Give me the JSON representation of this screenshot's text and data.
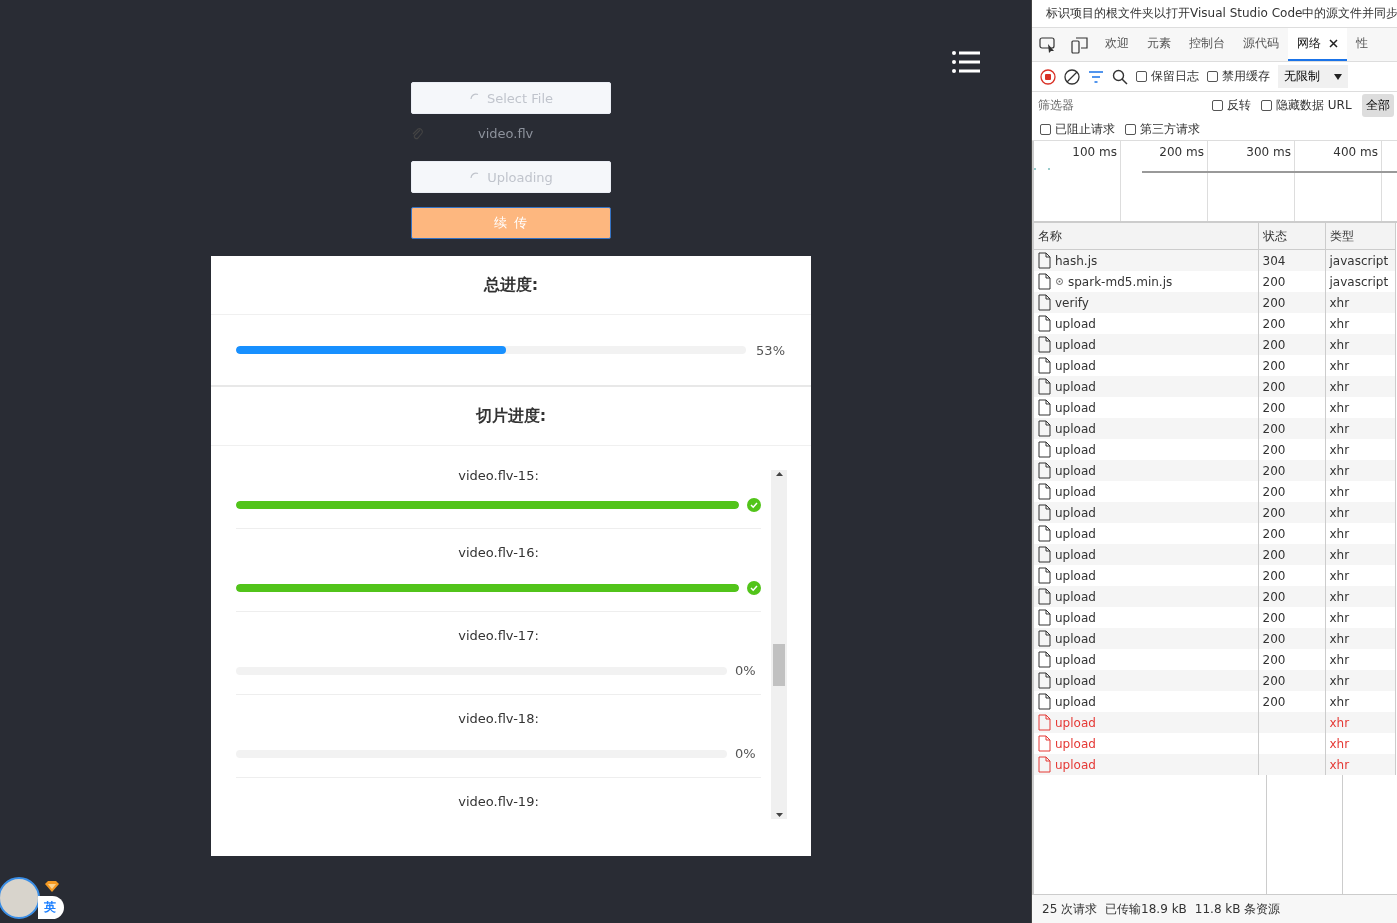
{
  "uploader": {
    "buttons": [
      {
        "kind": "select",
        "label": "Select File",
        "loading": true
      },
      {
        "kind": "file",
        "label": "video.flv"
      },
      {
        "kind": "upload",
        "label": "Uploading",
        "loading": true
      },
      {
        "kind": "resume",
        "label": "续 传",
        "focused": true
      }
    ]
  },
  "total_progress": {
    "title": "总进度:",
    "level": 0.53,
    "reading": "53%"
  },
  "chunk_progress": {
    "title": "切片进度:",
    "items": [
      {
        "label": "video.flv-15:",
        "level": 1,
        "completed": true
      },
      {
        "label": "video.flv-16:",
        "level": 1,
        "completed": true
      },
      {
        "label": "video.flv-17:",
        "level": 0,
        "completed": false,
        "reading": "0%"
      },
      {
        "label": "video.flv-18:",
        "level": 0,
        "completed": false,
        "reading": "0%"
      },
      {
        "label": "video.flv-19:"
      }
    ]
  },
  "user_badge": {
    "label": "英"
  },
  "devtools": {
    "info_bar": "标识项目的根文件夹以打开Visual Studio Code中的源文件并同步",
    "tabs": [
      {
        "label": "欢迎",
        "selected": false
      },
      {
        "label": "元素",
        "selected": false
      },
      {
        "label": "控制台",
        "selected": false
      },
      {
        "label": "源代码",
        "selected": false
      },
      {
        "label": "网络",
        "selected": true,
        "closable": true
      },
      {
        "label": "性",
        "selected": false
      }
    ],
    "toolbar": {
      "recording": true,
      "checkboxes": [
        {
          "label": "保留日志",
          "checked": false
        },
        {
          "label": "禁用缓存",
          "checked": false
        }
      ],
      "throttle": "无限制"
    },
    "filter": {
      "placeholder": "筛选器",
      "checkboxes": [
        {
          "label": "反转",
          "checked": false
        },
        {
          "label": "隐藏数据 URL",
          "checked": false
        }
      ],
      "type_button": {
        "label": "全部",
        "selected": true
      }
    },
    "request_filters": [
      {
        "label": "已阻止请求",
        "checked": false
      },
      {
        "label": "第三方请求",
        "checked": false
      }
    ],
    "timeline_ticks": [
      "100 ms",
      "200 ms",
      "300 ms",
      "400 ms"
    ],
    "columns": [
      "名称",
      "状态",
      "类型"
    ],
    "rows": [
      {
        "name": "hash.js",
        "status": "304",
        "type": "javascript",
        "failed": false
      },
      {
        "name": "spark-md5.min.js",
        "status": "200",
        "type": "javascript",
        "failed": false,
        "worker": true
      },
      {
        "name": "verify",
        "status": "200",
        "type": "xhr",
        "failed": false
      },
      {
        "name": "upload",
        "status": "200",
        "type": "xhr",
        "failed": false
      },
      {
        "name": "upload",
        "status": "200",
        "type": "xhr",
        "failed": false
      },
      {
        "name": "upload",
        "status": "200",
        "type": "xhr",
        "failed": false
      },
      {
        "name": "upload",
        "status": "200",
        "type": "xhr",
        "failed": false
      },
      {
        "name": "upload",
        "status": "200",
        "type": "xhr",
        "failed": false
      },
      {
        "name": "upload",
        "status": "200",
        "type": "xhr",
        "failed": false
      },
      {
        "name": "upload",
        "status": "200",
        "type": "xhr",
        "failed": false
      },
      {
        "name": "upload",
        "status": "200",
        "type": "xhr",
        "failed": false
      },
      {
        "name": "upload",
        "status": "200",
        "type": "xhr",
        "failed": false
      },
      {
        "name": "upload",
        "status": "200",
        "type": "xhr",
        "failed": false
      },
      {
        "name": "upload",
        "status": "200",
        "type": "xhr",
        "failed": false
      },
      {
        "name": "upload",
        "status": "200",
        "type": "xhr",
        "failed": false
      },
      {
        "name": "upload",
        "status": "200",
        "type": "xhr",
        "failed": false
      },
      {
        "name": "upload",
        "status": "200",
        "type": "xhr",
        "failed": false
      },
      {
        "name": "upload",
        "status": "200",
        "type": "xhr",
        "failed": false
      },
      {
        "name": "upload",
        "status": "200",
        "type": "xhr",
        "failed": false
      },
      {
        "name": "upload",
        "status": "200",
        "type": "xhr",
        "failed": false
      },
      {
        "name": "upload",
        "status": "200",
        "type": "xhr",
        "failed": false
      },
      {
        "name": "upload",
        "status": "200",
        "type": "xhr",
        "failed": false
      },
      {
        "name": "upload",
        "type": "xhr",
        "failed": true
      },
      {
        "name": "upload",
        "type": "xhr",
        "failed": true
      },
      {
        "name": "upload",
        "type": "xhr",
        "failed": true
      }
    ],
    "status_bar": [
      "25 次请求",
      "已传输18.9 kB",
      "11.8 kB 条资源"
    ]
  }
}
